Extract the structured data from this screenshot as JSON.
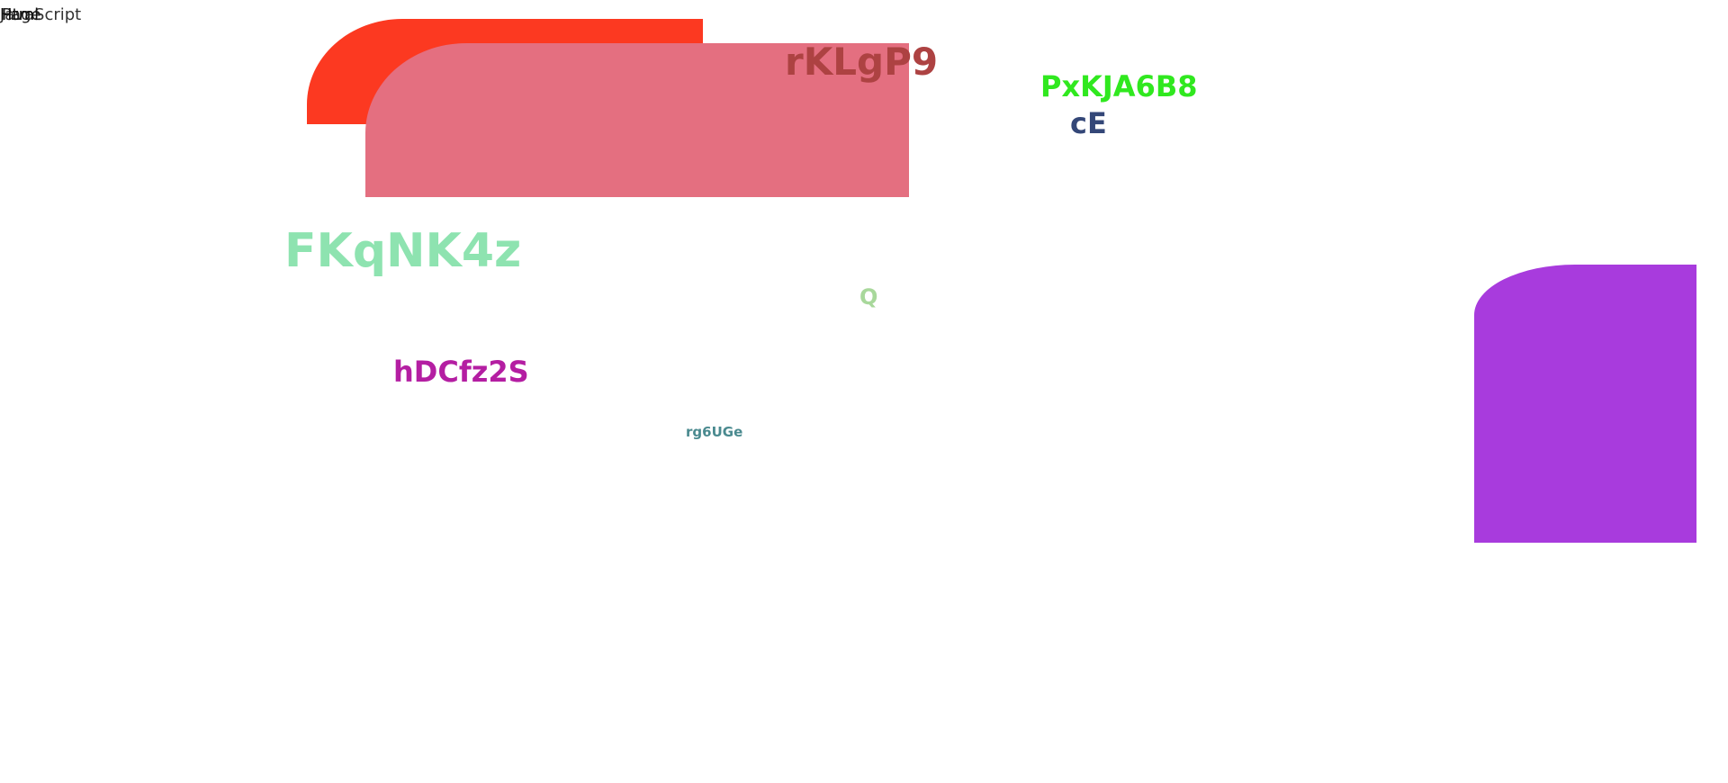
{
  "top_left": {
    "text_1": "JavaScript",
    "text_2": "Page",
    "text_3": "Html"
  },
  "shapes": {
    "red_color": "#fc3921",
    "pink_color": "#e46f80",
    "purple_color": "#a83bdd"
  },
  "labels": {
    "rklgp9": "rKLgP9",
    "pxkja6b8": "PxKJA6B8",
    "ce": "cE",
    "fkqnk4z": "FKqNK4z",
    "q": "Q",
    "hdcfz2s": "hDCfz2S",
    "rg6uge": "rg6UGe"
  }
}
